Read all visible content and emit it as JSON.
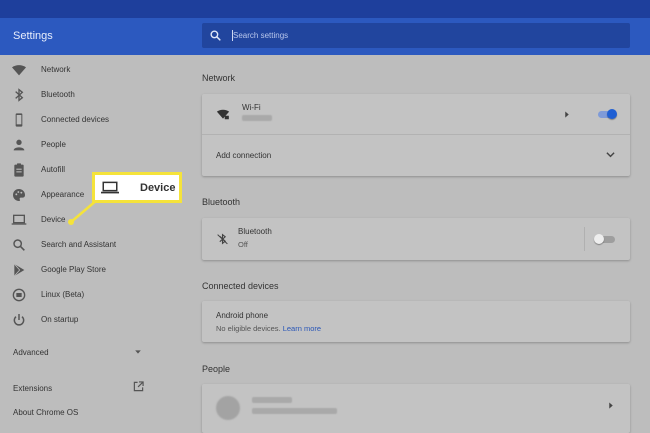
{
  "header": {
    "title": "Settings",
    "search": {
      "placeholder": "Search settings",
      "value": ""
    }
  },
  "sidebar": {
    "items": [
      {
        "label": "Network",
        "icon": "wifi-icon"
      },
      {
        "label": "Bluetooth",
        "icon": "bluetooth-icon"
      },
      {
        "label": "Connected devices",
        "icon": "phone-icon"
      },
      {
        "label": "People",
        "icon": "person-icon"
      },
      {
        "label": "Autofill",
        "icon": "clipboard-icon"
      },
      {
        "label": "Appearance",
        "icon": "palette-icon"
      },
      {
        "label": "Device",
        "icon": "laptop-icon"
      },
      {
        "label": "Search and Assistant",
        "icon": "search-icon"
      },
      {
        "label": "Google Play Store",
        "icon": "play-store-icon"
      },
      {
        "label": "Linux (Beta)",
        "icon": "linux-icon"
      },
      {
        "label": "On startup",
        "icon": "power-icon"
      }
    ],
    "advanced": "Advanced",
    "extensions": "Extensions",
    "about": "About Chrome OS"
  },
  "callout": {
    "label": "Device",
    "icon": "laptop-icon",
    "color": "#f5e33a"
  },
  "main": {
    "network": {
      "title": "Network",
      "wifi_label": "Wi-Fi",
      "wifi_enabled": true,
      "add_connection": "Add connection"
    },
    "bluetooth": {
      "title": "Bluetooth",
      "label": "Bluetooth",
      "status": "Off",
      "enabled": false
    },
    "connected_devices": {
      "title": "Connected devices",
      "device": "Android phone",
      "status": "No eligible devices.",
      "learn_more": "Learn more"
    },
    "people": {
      "title": "People"
    }
  },
  "colors": {
    "accent": "#2c59bf",
    "link": "#2a56b7",
    "toggle_on": "#1f5fd3"
  }
}
